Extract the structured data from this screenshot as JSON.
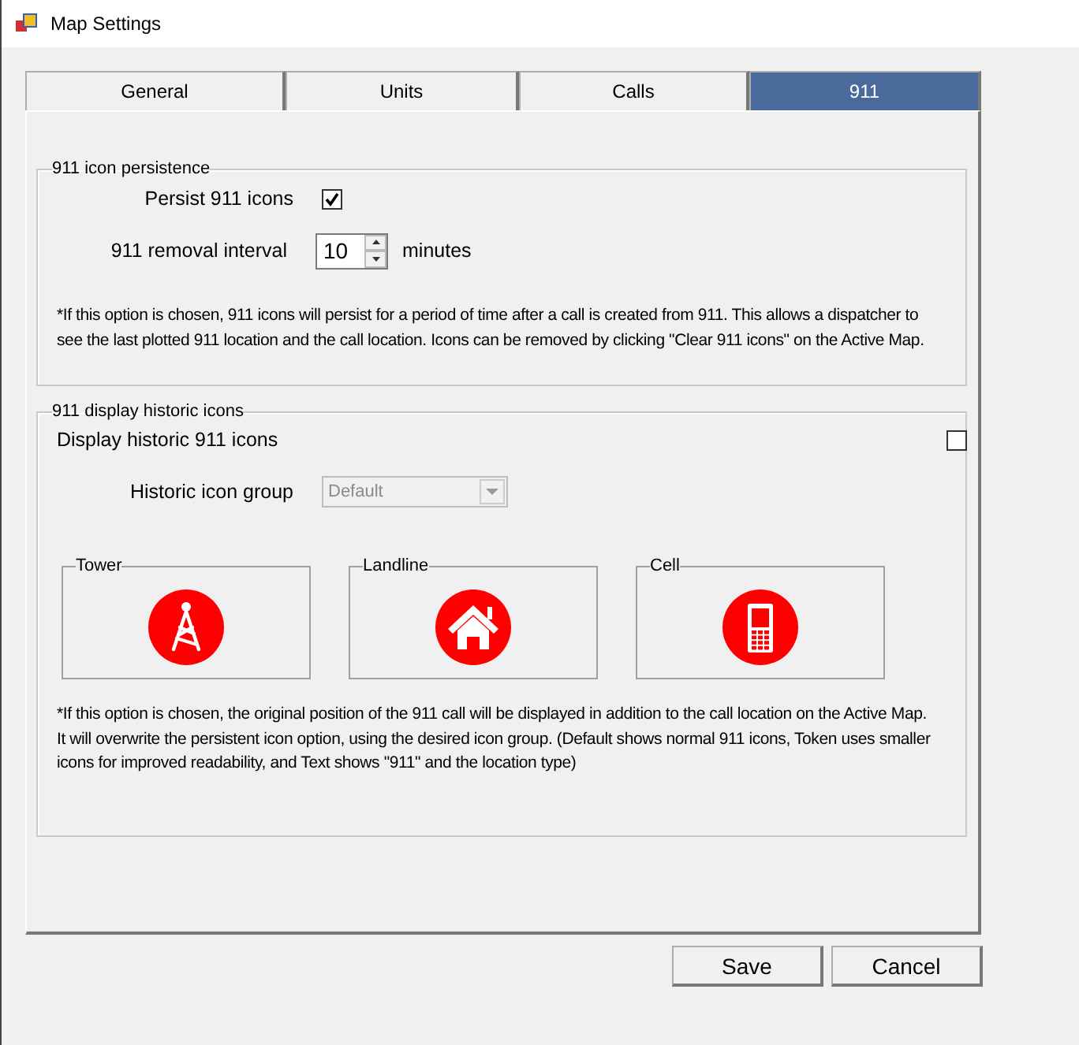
{
  "window": {
    "title": "Map Settings"
  },
  "tabs": [
    {
      "label": "General",
      "selected": false
    },
    {
      "label": "Units",
      "selected": false
    },
    {
      "label": "Calls",
      "selected": false
    },
    {
      "label": "911",
      "selected": true
    }
  ],
  "persistence": {
    "legend": "911 icon persistence",
    "persist": {
      "label": "Persist 911 icons",
      "checked": true
    },
    "interval": {
      "label": "911 removal interval",
      "value": "10",
      "unit": "minutes"
    },
    "note": "*If this option is chosen, 911 icons will persist for a period of time after a call is created from 911. This allows a dispatcher to see the last plotted 911 location and the call location. Icons can be removed by clicking \"Clear 911 icons\" on the Active Map."
  },
  "historic": {
    "legend": "911 display historic icons",
    "display": {
      "label": "Display historic 911 icons",
      "checked": false
    },
    "group": {
      "label": "Historic icon group",
      "value": "Default",
      "disabled": true
    },
    "previews": [
      {
        "label": "Tower",
        "kind": "tower"
      },
      {
        "label": "Landline",
        "kind": "house"
      },
      {
        "label": "Cell",
        "kind": "phone"
      }
    ],
    "note": "*If this option is chosen, the original position of the 911 call will be displayed in addition to the call location on the Active Map. It will overwrite the persistent icon option, using the desired icon group. (Default shows normal 911 icons, Token uses smaller icons for improved readability, and Text shows \"911\" and the location type)"
  },
  "buttons": [
    "Save",
    "Cancel"
  ]
}
